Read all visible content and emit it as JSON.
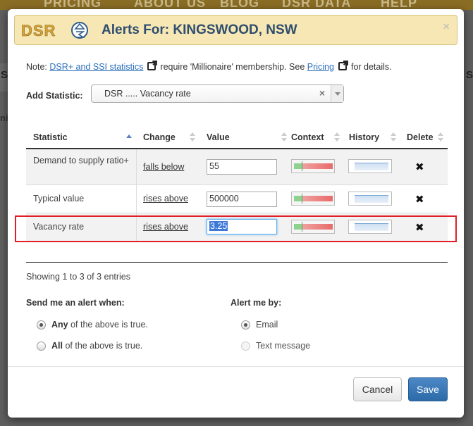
{
  "background": {
    "nav_items": [
      "PRICING",
      "ABOUT US",
      "BLOG",
      "DSR DATA",
      "HELP"
    ]
  },
  "modal": {
    "title": "Alerts For: KINGSWOOD, NSW",
    "logo_text": "DSR",
    "close_glyph": "×",
    "note": {
      "prefix": "Note: ",
      "link1": "DSR+ and SSI statistics",
      "middle": "require 'Millionaire' membership. See",
      "link2": "Pricing",
      "suffix": "for details."
    },
    "add_statistic": {
      "label": "Add Statistic:",
      "selected": "DSR ..... Vacancy rate",
      "clear_glyph": "×"
    },
    "table": {
      "headers": {
        "statistic": "Statistic",
        "change": "Change",
        "value": "Value",
        "context": "Context",
        "history": "History",
        "delete": "Delete"
      },
      "rows": [
        {
          "statistic": "Demand to supply ratio+",
          "change": "falls below",
          "value": "55"
        },
        {
          "statistic": "Typical value",
          "change": "rises above",
          "value": "500000"
        },
        {
          "statistic": "Vacancy rate",
          "change": "rises above",
          "value": "3.25"
        }
      ],
      "delete_glyph": "✖",
      "highlighted_row": 2
    },
    "showing": "Showing 1 to 3 of 3 entries",
    "send_when": {
      "label": "Send me an alert when:",
      "options": [
        {
          "bold": "Any",
          "rest": " of the above is true.",
          "checked": true
        },
        {
          "bold": "All",
          "rest": " of the above is true.",
          "checked": false
        }
      ]
    },
    "alert_by": {
      "label": "Alert me by:",
      "options": [
        {
          "label": "Email",
          "checked": true,
          "disabled": false
        },
        {
          "label": "Text message",
          "checked": false,
          "disabled": true
        }
      ]
    },
    "buttons": {
      "cancel": "Cancel",
      "save": "Save"
    },
    "colors": {
      "header_bg": "#f6e7b4",
      "title": "#2f4d6e",
      "link": "#2a6ebb",
      "highlight": "#e01f26",
      "save_button": "#2d6aa8"
    }
  }
}
